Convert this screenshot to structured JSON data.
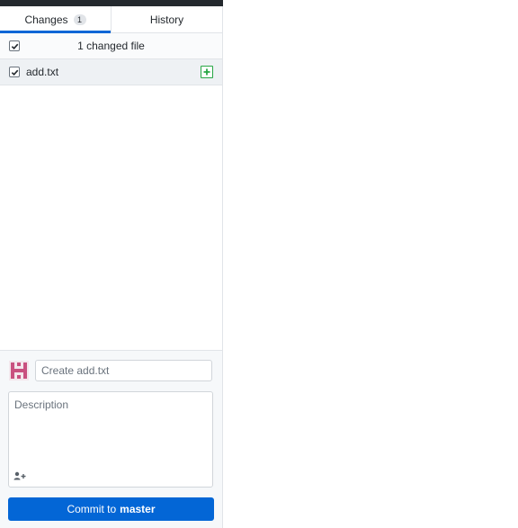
{
  "tabs": {
    "changes_label": "Changes",
    "changes_count": "1",
    "history_label": "History"
  },
  "changes": {
    "summary": "1 changed file",
    "select_all_checked": true,
    "files": [
      {
        "name": "add.txt",
        "checked": true,
        "status": "added",
        "status_icon": "plus-square-icon"
      }
    ]
  },
  "commit": {
    "summary_placeholder": "Create add.txt",
    "description_placeholder": "Description",
    "coauthor_icon": "person-add-icon",
    "button_prefix": "Commit to",
    "branch": "master"
  },
  "colors": {
    "accent": "#0366d6",
    "added": "#28a745",
    "avatar": "#c9507f"
  }
}
